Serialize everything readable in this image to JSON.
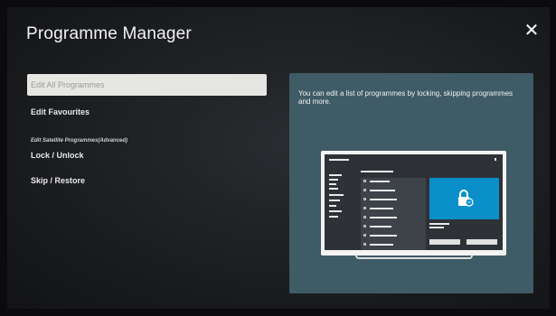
{
  "header": {
    "title": "Programme Manager",
    "close_glyph": "✕"
  },
  "menu": {
    "items": [
      {
        "label": "Edit All Programmes"
      },
      {
        "label": "Edit Favourites"
      }
    ],
    "section_label": "Edit Satellite Programmes(Advanced)",
    "section_items": [
      {
        "label": "Lock / Unlock"
      },
      {
        "label": "Skip / Restore"
      }
    ]
  },
  "panel": {
    "description": "You can edit a list of programmes by locking, skipping programmes and more.",
    "illustration": "tv-lock-illustration",
    "accent": "#0a8fc9",
    "background": "#3f5b66"
  },
  "icons": {
    "close": "close-icon",
    "lock": "lock-icon"
  }
}
